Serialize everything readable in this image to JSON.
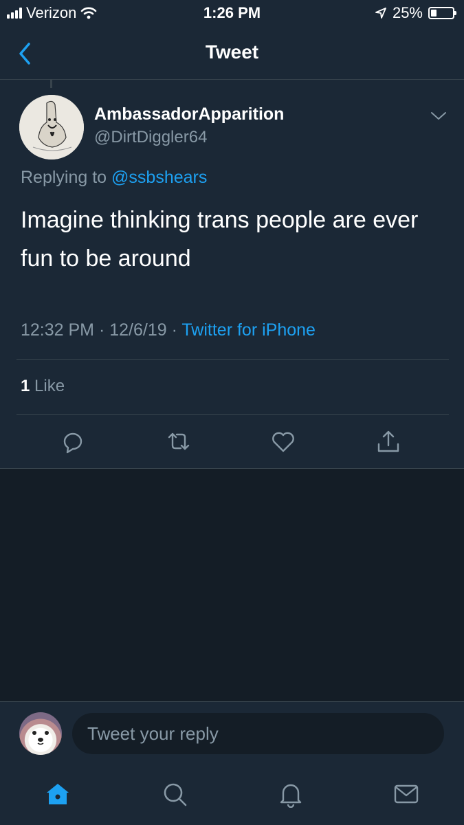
{
  "status_bar": {
    "carrier": "Verizon",
    "time": "1:26 PM",
    "battery": "25%",
    "battery_level": 0.25,
    "icons": [
      "signal-icon",
      "wifi-icon",
      "location-icon",
      "battery-icon"
    ]
  },
  "nav": {
    "title": "Tweet",
    "back_icon": "back-chevron-icon"
  },
  "tweet": {
    "display_name": "AmbassadorApparition",
    "handle": "@DirtDiggler64",
    "replying_prefix": "Replying to ",
    "replying_to": "@ssbshears",
    "text": "Imagine thinking trans people are ever fun to be around",
    "timestamp": "12:32 PM · 12/6/19 · ",
    "source": "Twitter for iPhone",
    "like_count": "1",
    "like_label": " Like",
    "actions": [
      "reply-icon",
      "retweet-icon",
      "like-icon",
      "share-icon"
    ]
  },
  "reply_bar": {
    "placeholder": "Tweet your reply"
  },
  "tab_bar": {
    "tabs": [
      "home-icon",
      "search-icon",
      "notifications-icon",
      "messages-icon"
    ],
    "active": "home-icon"
  },
  "colors": {
    "background": "#141d26",
    "surface": "#1b2836",
    "accent": "#1da1f2",
    "muted": "#8899a6",
    "divider": "#38444d"
  }
}
